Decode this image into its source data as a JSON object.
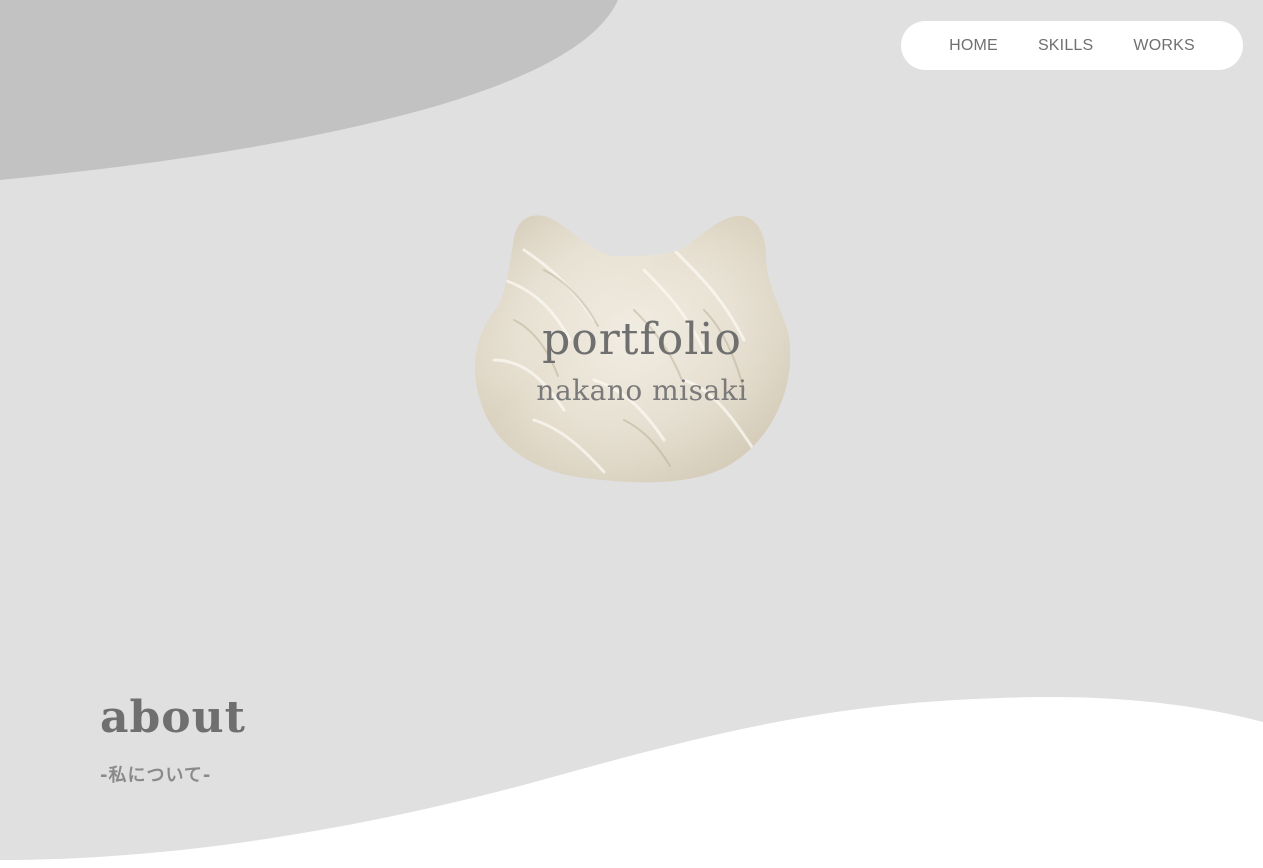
{
  "nav": {
    "items": [
      {
        "label": "HOME"
      },
      {
        "label": "SKILLS"
      },
      {
        "label": "WORKS"
      }
    ]
  },
  "hero": {
    "title": "portfolio",
    "subtitle": "nakano misaki",
    "image_icon": "cat-head-fur-image"
  },
  "about": {
    "heading": "about",
    "subheading": "-私について-"
  },
  "colors": {
    "background": "#e0e0e0",
    "top_blob": "#c2c2c2",
    "bottom_wave": "#ffffff",
    "nav_bg": "#ffffff",
    "text_primary": "#6f6f6f",
    "text_secondary": "#8a8a8a"
  }
}
